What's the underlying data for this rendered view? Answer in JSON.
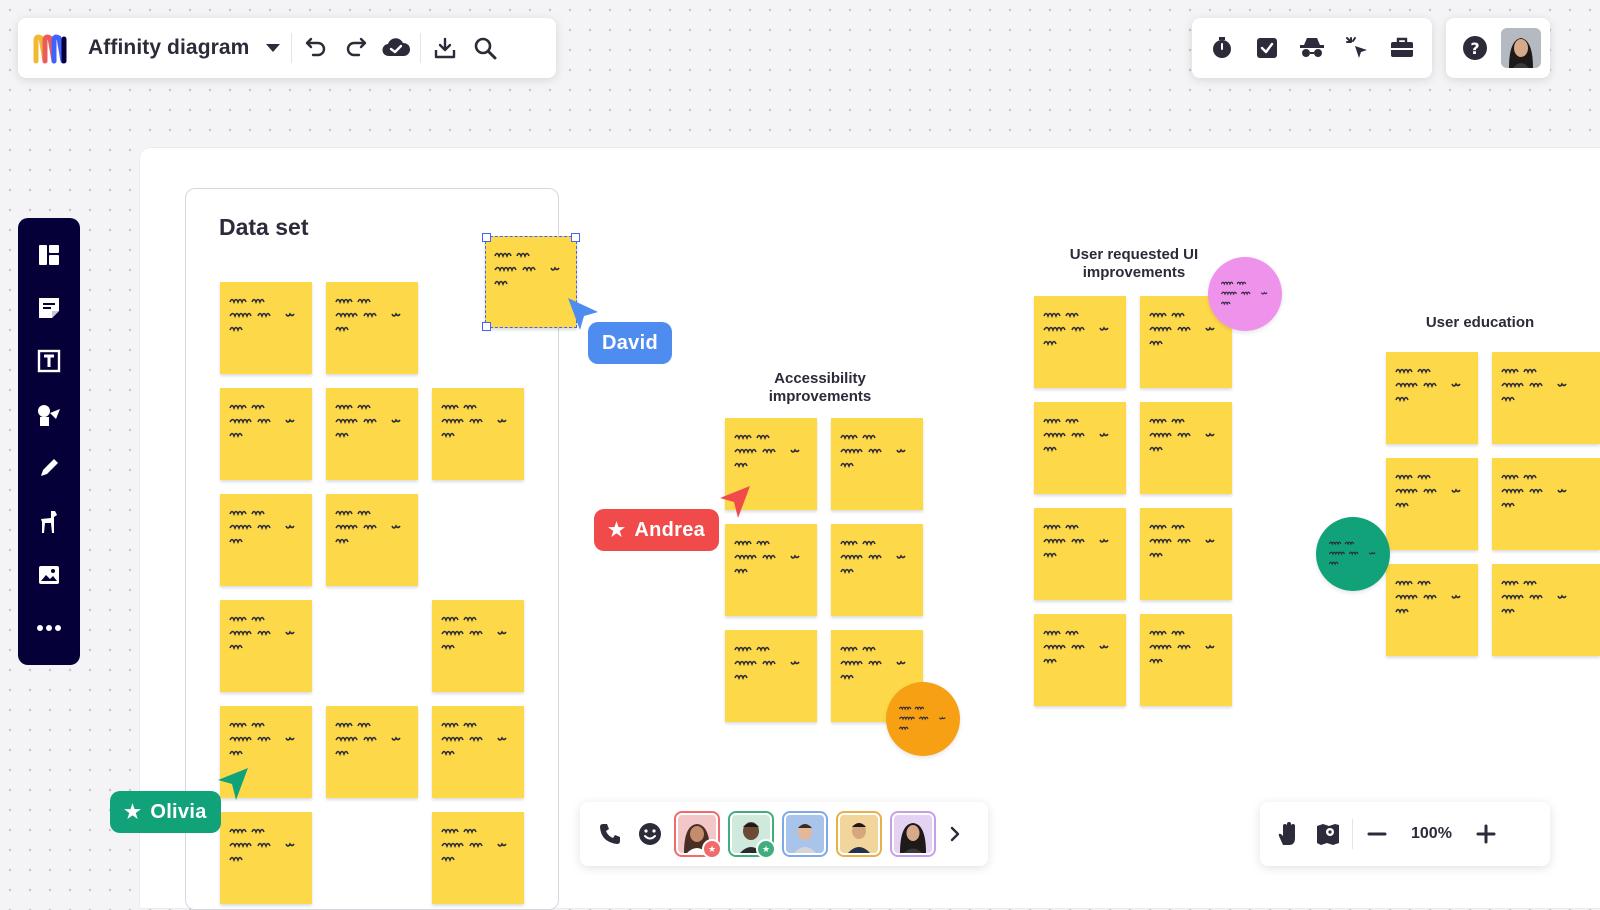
{
  "app": {
    "board_title": "Affinity diagram",
    "accent_color": "#4262ff",
    "toolbar_bg": "#050038",
    "sticky_color": "#fdd94a"
  },
  "top_toolbar": {
    "icons": [
      "logo-icon",
      "chevron-down-icon",
      "undo-icon",
      "redo-icon",
      "cloud-check-icon",
      "export-icon",
      "search-icon"
    ]
  },
  "top_right_tools": {
    "icons": [
      "timer-icon",
      "task-check-icon",
      "private-mode-icon",
      "cursor-click-icon",
      "toolbox-icon"
    ]
  },
  "account": {
    "icons": [
      "help-icon",
      "user-avatar"
    ]
  },
  "left_toolbar": {
    "icons": [
      "templates-icon",
      "sticky-note-icon",
      "text-icon",
      "shapes-icon",
      "pen-icon",
      "animal-icon",
      "image-icon",
      "more-icon"
    ]
  },
  "canvas": {
    "dataset_title": "Data set",
    "clusters": [
      {
        "title": "Accessibility improvements",
        "sticky_count": 6,
        "dot_color": "#f7a014"
      },
      {
        "title": "User requested UI improvements",
        "sticky_count": 8,
        "dot_color": "#ee92ec"
      },
      {
        "title": "User education",
        "sticky_count": 6,
        "dot_color": "#12a27a"
      }
    ]
  },
  "cursors": [
    {
      "name": "David",
      "color": "#4e8cf0",
      "starred": false
    },
    {
      "name": "Andrea",
      "color": "#f04a4a",
      "starred": true
    },
    {
      "name": "Olivia",
      "color": "#12a27a",
      "starred": true
    }
  ],
  "collab_bar": {
    "icons": [
      "phone-icon",
      "emoji-icon",
      "chevron-right-icon"
    ],
    "avatar_colors": [
      "#f06b6b",
      "#3fae7c",
      "#7fa9e8",
      "#e8b04a",
      "#c99ee8"
    ]
  },
  "zoom_bar": {
    "zoom_level": "100%",
    "icons": [
      "hand-icon",
      "map-pin-icon",
      "zoom-out-icon",
      "zoom-in-icon"
    ]
  }
}
